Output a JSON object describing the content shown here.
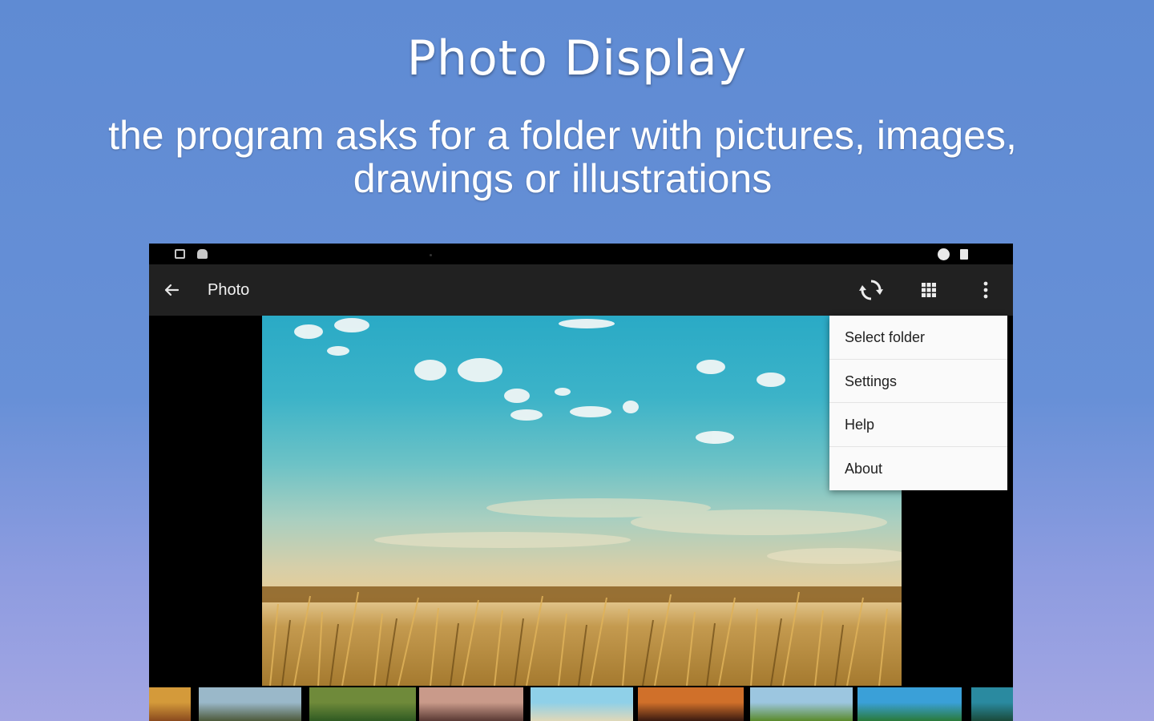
{
  "promo": {
    "title": "Photo Display",
    "subtitle_line1": "the program asks for a folder with pictures, images,",
    "subtitle_line2": "drawings or illustrations"
  },
  "statusbar": {
    "icons": [
      "gallery-icon",
      "android-icon",
      "circle-icon",
      "battery-icon"
    ]
  },
  "toolbar": {
    "title": "Photo",
    "icons": [
      "back-arrow-icon",
      "refresh-icon",
      "grid-icon",
      "more-vert-icon"
    ]
  },
  "overflow_menu": {
    "items": [
      {
        "label": "Select folder"
      },
      {
        "label": "Settings"
      },
      {
        "label": "Help"
      },
      {
        "label": "About"
      }
    ]
  },
  "colors": {
    "background_top": "#5f8bd3",
    "background_bottom": "#a3a6e3",
    "toolbar": "#212121",
    "menu": "#fafafa",
    "menu_text": "#212121"
  },
  "filmstrip": {
    "thumbnails": [
      {
        "name": "sunset-thumb",
        "colors": [
          "#d49a3a",
          "#8a4a1e"
        ]
      },
      {
        "name": "mountain-coast-thumb",
        "colors": [
          "#9ab8c9",
          "#4d5a3a"
        ]
      },
      {
        "name": "green-field-thumb",
        "colors": [
          "#6f8a3a",
          "#2f5a22"
        ]
      },
      {
        "name": "rocky-shore-thumb",
        "colors": [
          "#c99a8a",
          "#5a3a34"
        ]
      },
      {
        "name": "beach-sky-thumb",
        "colors": [
          "#8fd0e8",
          "#e0d8b8"
        ]
      },
      {
        "name": "palm-sunset-thumb",
        "colors": [
          "#d0702a",
          "#3a1a10"
        ]
      },
      {
        "name": "tree-meadow-thumb",
        "colors": [
          "#9cc6e0",
          "#5a8a2a"
        ]
      },
      {
        "name": "tropical-lagoon-thumb",
        "colors": [
          "#3aa0d8",
          "#2a7a3a"
        ]
      },
      {
        "name": "island-thumb",
        "colors": [
          "#2a8aa0",
          "#1a4a3a"
        ]
      }
    ]
  }
}
